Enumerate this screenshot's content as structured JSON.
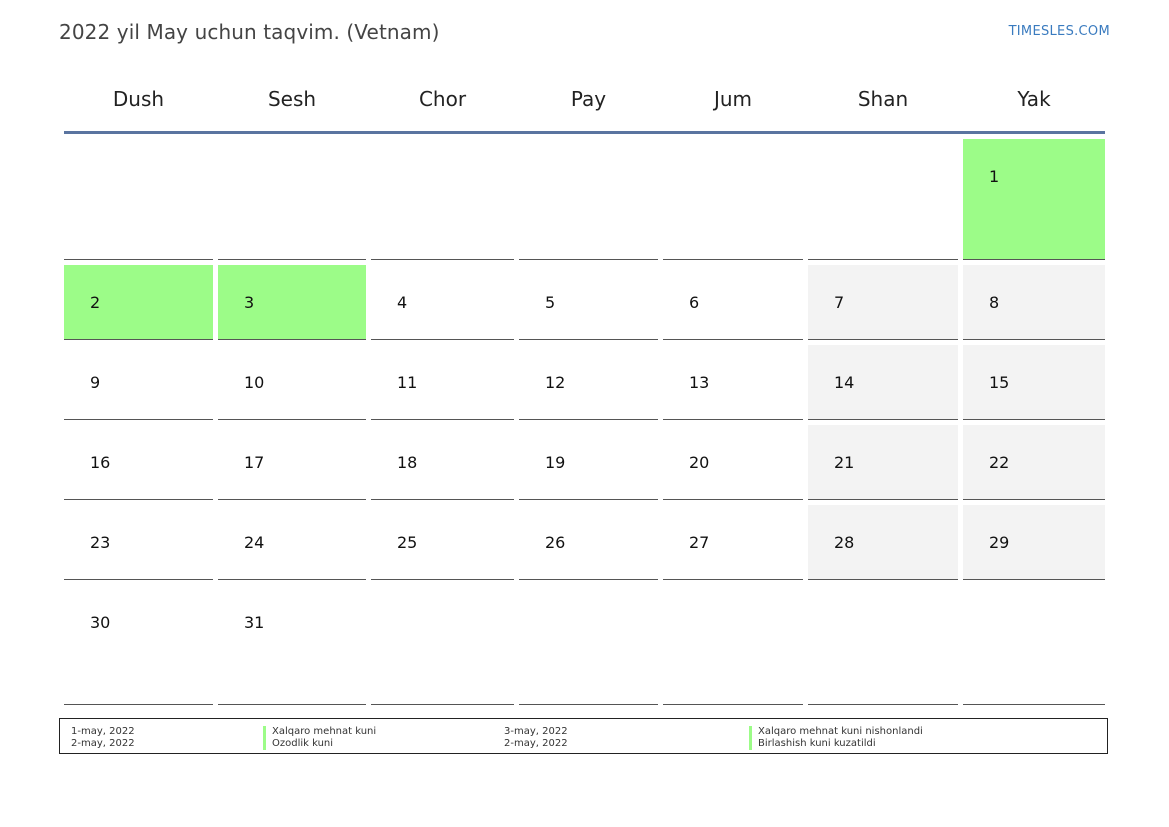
{
  "header": {
    "title": "2022 yil May uchun taqvim. (Vetnam)",
    "brand": "TIMESLES.COM"
  },
  "weekdays": [
    "Dush",
    "Sesh",
    "Chor",
    "Pay",
    "Jum",
    "Shan",
    "Yak"
  ],
  "weeks": [
    [
      {
        "day": "",
        "type": "blank"
      },
      {
        "day": "",
        "type": "blank"
      },
      {
        "day": "",
        "type": "blank"
      },
      {
        "day": "",
        "type": "blank"
      },
      {
        "day": "",
        "type": "blank"
      },
      {
        "day": "",
        "type": "blank"
      },
      {
        "day": "1",
        "type": "holiday"
      }
    ],
    [
      {
        "day": "2",
        "type": "holiday"
      },
      {
        "day": "3",
        "type": "holiday"
      },
      {
        "day": "4",
        "type": "normal"
      },
      {
        "day": "5",
        "type": "normal"
      },
      {
        "day": "6",
        "type": "normal"
      },
      {
        "day": "7",
        "type": "weekend"
      },
      {
        "day": "8",
        "type": "weekend"
      }
    ],
    [
      {
        "day": "9",
        "type": "normal"
      },
      {
        "day": "10",
        "type": "normal"
      },
      {
        "day": "11",
        "type": "normal"
      },
      {
        "day": "12",
        "type": "normal"
      },
      {
        "day": "13",
        "type": "normal"
      },
      {
        "day": "14",
        "type": "weekend"
      },
      {
        "day": "15",
        "type": "weekend"
      }
    ],
    [
      {
        "day": "16",
        "type": "normal"
      },
      {
        "day": "17",
        "type": "normal"
      },
      {
        "day": "18",
        "type": "normal"
      },
      {
        "day": "19",
        "type": "normal"
      },
      {
        "day": "20",
        "type": "normal"
      },
      {
        "day": "21",
        "type": "weekend"
      },
      {
        "day": "22",
        "type": "weekend"
      }
    ],
    [
      {
        "day": "23",
        "type": "normal"
      },
      {
        "day": "24",
        "type": "normal"
      },
      {
        "day": "25",
        "type": "normal"
      },
      {
        "day": "26",
        "type": "normal"
      },
      {
        "day": "27",
        "type": "normal"
      },
      {
        "day": "28",
        "type": "weekend"
      },
      {
        "day": "29",
        "type": "weekend"
      }
    ],
    [
      {
        "day": "30",
        "type": "normal"
      },
      {
        "day": "31",
        "type": "normal"
      },
      {
        "day": "",
        "type": "normal"
      },
      {
        "day": "",
        "type": "normal"
      },
      {
        "day": "",
        "type": "normal"
      },
      {
        "day": "",
        "type": "normal"
      },
      {
        "day": "",
        "type": "normal"
      }
    ]
  ],
  "legend": [
    {
      "date": "1-may, 2022",
      "name": "Xalqaro mehnat kuni"
    },
    {
      "date": "2-may, 2022",
      "name": "Ozodlik kuni"
    },
    {
      "date": "3-may, 2022",
      "name": "Xalqaro mehnat kuni nishonlandi"
    },
    {
      "date": "2-may, 2022",
      "name": "Birlashish kuni kuzatildi"
    }
  ],
  "colors": {
    "holiday": "#9cfc88",
    "weekend": "#f3f3f3",
    "header_rule": "#5a74a0",
    "brand": "#3a7bbf"
  }
}
